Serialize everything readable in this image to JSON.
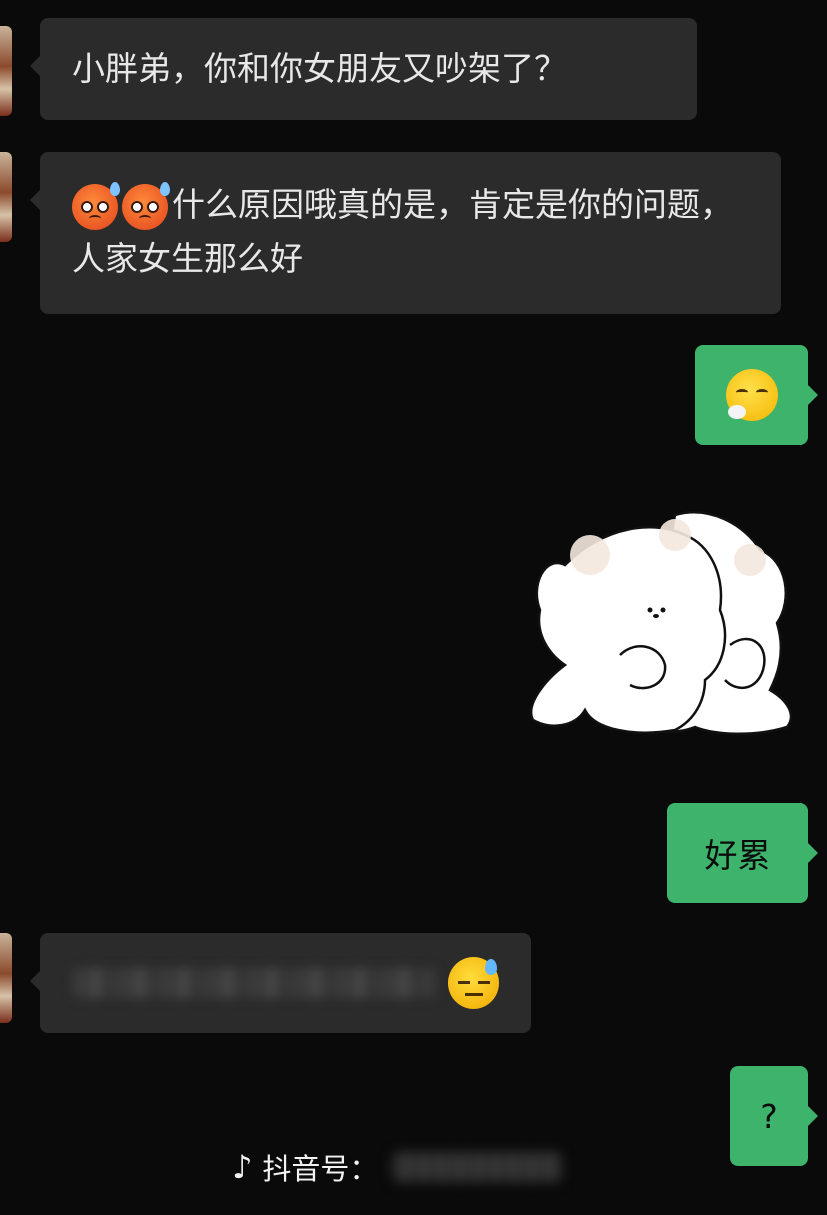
{
  "messages": [
    {
      "side": "in",
      "text": "小胖弟，你和你女朋友又吵架了？"
    },
    {
      "side": "in",
      "text": "什么原因哦真的是，肯定是你的问题，人家女生那么好",
      "emojis": [
        "hot-face-icon",
        "hot-face-icon"
      ]
    },
    {
      "side": "out",
      "emoji": "sighing-face-icon"
    },
    {
      "side": "out",
      "sticker": "hugging-bears-sticker"
    },
    {
      "side": "out",
      "text": "好累"
    },
    {
      "side": "in",
      "emoji": "sweat-face-icon"
    },
    {
      "side": "out",
      "text": "?"
    }
  ],
  "footer": {
    "label": "抖音号："
  },
  "colors": {
    "background": "#0a0a0a",
    "bubble_in": "#2b2b2b",
    "bubble_out": "#3db36b"
  }
}
